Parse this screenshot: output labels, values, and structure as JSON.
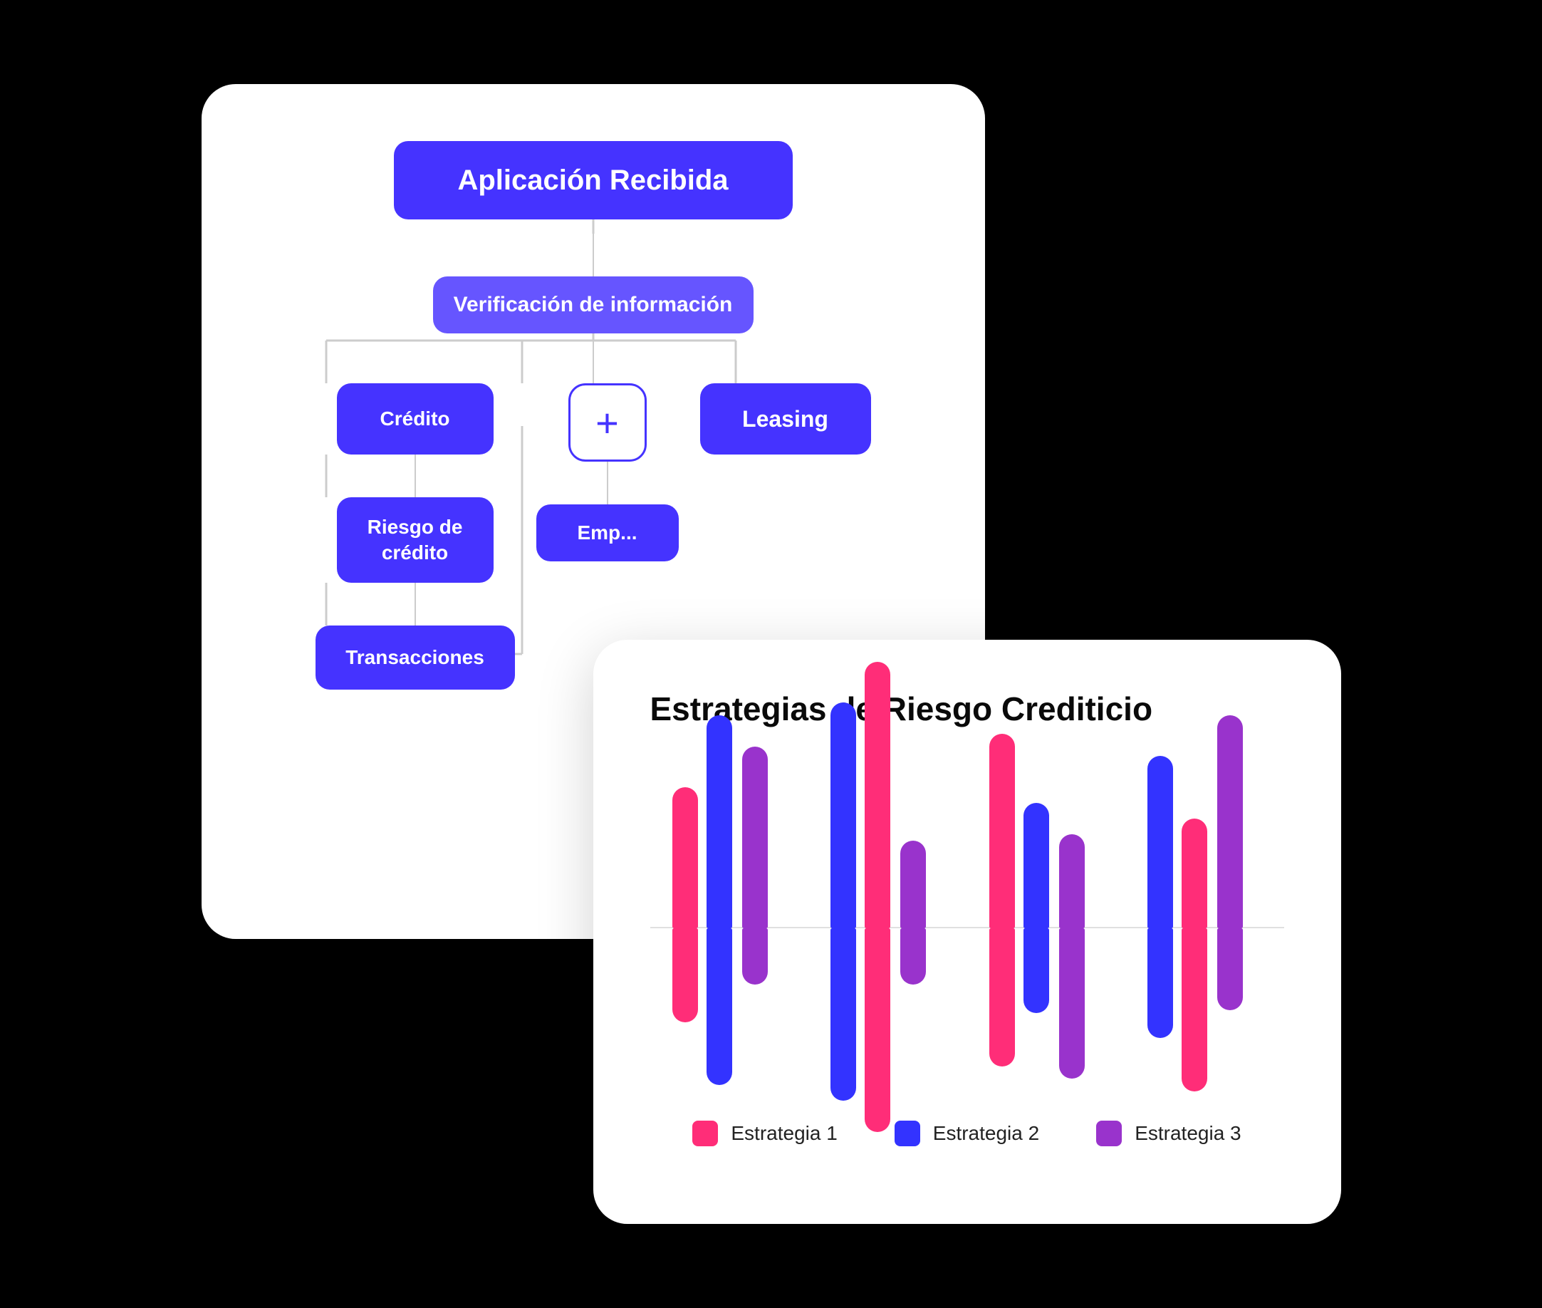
{
  "flow": {
    "node_top": "Aplicación Recibida",
    "node_verify": "Verificación de información",
    "node_credito": "Crédito",
    "node_plus": "+",
    "node_leasing": "Leasing",
    "node_riesgo": "Riesgo de crédito",
    "node_empresa": "Emp...",
    "node_transacciones": "Transacciones"
  },
  "chart": {
    "title": "Estrategias de Riesgo Crediticio",
    "legend": [
      {
        "id": "estrategia1",
        "label": "Estrategia 1",
        "color": "#FF2D78"
      },
      {
        "id": "estrategia2",
        "label": "Estrategia 2",
        "color": "#3333FF"
      },
      {
        "id": "estrategia3",
        "label": "Estrategia 3",
        "color": "#9933CC"
      }
    ],
    "groups": [
      {
        "bars": [
          {
            "color": "pink",
            "upPct": 55,
            "downPct": 35
          },
          {
            "color": "blue",
            "upPct": 75,
            "downPct": 55
          },
          {
            "color": "purple",
            "upPct": 65,
            "downPct": 20
          }
        ]
      },
      {
        "bars": [
          {
            "color": "blue",
            "upPct": 80,
            "downPct": 60
          },
          {
            "color": "pink",
            "upPct": 90,
            "downPct": 70
          },
          {
            "color": "purple",
            "upPct": 30,
            "downPct": 20
          }
        ]
      },
      {
        "bars": [
          {
            "color": "pink",
            "upPct": 70,
            "downPct": 50
          },
          {
            "color": "blue",
            "upPct": 45,
            "downPct": 30
          },
          {
            "color": "purple",
            "upPct": 35,
            "downPct": 55
          }
        ]
      },
      {
        "bars": [
          {
            "color": "blue",
            "upPct": 60,
            "downPct": 40
          },
          {
            "color": "pink",
            "upPct": 40,
            "downPct": 60
          },
          {
            "color": "purple",
            "upPct": 75,
            "downPct": 30
          }
        ]
      }
    ]
  }
}
